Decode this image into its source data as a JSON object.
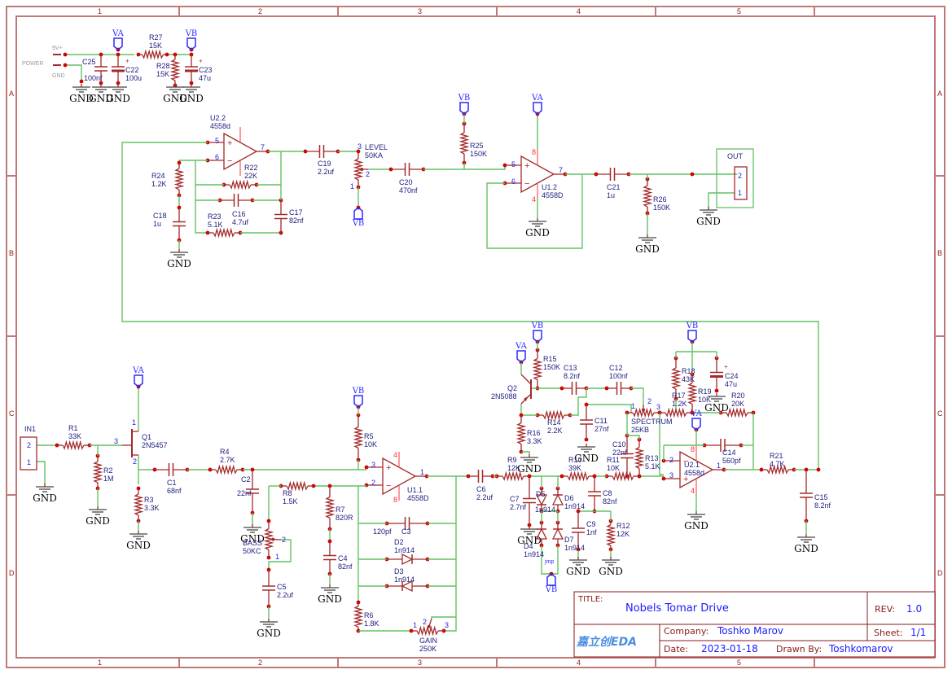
{
  "sheet": {
    "columns": [
      "1",
      "2",
      "3",
      "4",
      "5"
    ],
    "rows": [
      "A",
      "B",
      "C",
      "D"
    ]
  },
  "colors": {
    "wire": "#63c163",
    "part": "#a52a2a",
    "text": "#202080",
    "net": "#2b2bff",
    "junction": "#d40000",
    "frame": "#c07878"
  },
  "power": {
    "vplus": "9V+",
    "title": "POWER",
    "gnd": "GND"
  },
  "gnd_label": "GND",
  "nets": {
    "va": "VA",
    "vb": "VB"
  },
  "jmp_label": "jmp",
  "components": [
    {
      "ref": "C25",
      "value": "100nf"
    },
    {
      "ref": "C22",
      "value": "100u"
    },
    {
      "ref": "R27",
      "value": "15K"
    },
    {
      "ref": "R28",
      "value": "15K"
    },
    {
      "ref": "C23",
      "value": "47u"
    },
    {
      "ref": "U2.2",
      "value": "4558d",
      "pins": [
        "5",
        "6",
        "7"
      ]
    },
    {
      "ref": "R24",
      "value": "1.2K"
    },
    {
      "ref": "C18",
      "value": "1u"
    },
    {
      "ref": "R22",
      "value": "22K"
    },
    {
      "ref": "C16",
      "value": "4.7uf"
    },
    {
      "ref": "R23",
      "value": "5.1K"
    },
    {
      "ref": "C17",
      "value": "82nf"
    },
    {
      "ref": "C19",
      "value": "2.2uf"
    },
    {
      "ref": "LEVEL",
      "value": "50KA",
      "pins": [
        "3",
        "1",
        "2"
      ]
    },
    {
      "ref": "C20",
      "value": "470nf"
    },
    {
      "ref": "R25",
      "value": "150K"
    },
    {
      "ref": "U1.2",
      "value": "4558D",
      "pins": [
        "5",
        "6",
        "7",
        "8",
        "4"
      ]
    },
    {
      "ref": "C21",
      "value": "1u"
    },
    {
      "ref": "R26",
      "value": "150K"
    },
    {
      "ref": "OUT",
      "value": "",
      "pins": [
        "2",
        "1"
      ]
    },
    {
      "ref": "IN1",
      "value": "",
      "pins": [
        "2",
        "1"
      ]
    },
    {
      "ref": "R1",
      "value": "33K"
    },
    {
      "ref": "R2",
      "value": "1M"
    },
    {
      "ref": "Q1",
      "value": "2N5457",
      "pins": [
        "3",
        "1",
        "2"
      ]
    },
    {
      "ref": "R3",
      "value": "3.3K"
    },
    {
      "ref": "C1",
      "value": "68nf"
    },
    {
      "ref": "R4",
      "value": "2.7K"
    },
    {
      "ref": "C2",
      "value": "22nf"
    },
    {
      "ref": "R5",
      "value": "10K"
    },
    {
      "ref": "U1.1",
      "value": "4558D",
      "pins": [
        "3",
        "2",
        "1",
        "4",
        "8"
      ]
    },
    {
      "ref": "R8",
      "value": "1.5K"
    },
    {
      "ref": "R7",
      "value": "820R"
    },
    {
      "ref": "C4",
      "value": "82nf"
    },
    {
      "ref": "BASS",
      "value": "50KC",
      "pins": [
        "2",
        "1"
      ]
    },
    {
      "ref": "C5",
      "value": "2.2uf"
    },
    {
      "ref": "C3",
      "value": "120pf"
    },
    {
      "ref": "D2",
      "value": "1n914"
    },
    {
      "ref": "D3",
      "value": "1n914"
    },
    {
      "ref": "R6",
      "value": "1.8K"
    },
    {
      "ref": "GAIN",
      "value": "250K",
      "pins": [
        "1",
        "2",
        "3"
      ]
    },
    {
      "ref": "C6",
      "value": "2.2uf"
    },
    {
      "ref": "R9",
      "value": "12K"
    },
    {
      "ref": "C7",
      "value": "2.7nf"
    },
    {
      "ref": "D5",
      "value": "1n914"
    },
    {
      "ref": "D6",
      "value": "1n914"
    },
    {
      "ref": "D4",
      "value": "1n914"
    },
    {
      "ref": "D7",
      "value": "1n914"
    },
    {
      "ref": "R10",
      "value": "39K"
    },
    {
      "ref": "R11",
      "value": "10K"
    },
    {
      "ref": "C8",
      "value": "82nf"
    },
    {
      "ref": "C9",
      "value": "1nf"
    },
    {
      "ref": "R12",
      "value": "12K"
    },
    {
      "ref": "C10",
      "value": "22nf"
    },
    {
      "ref": "R13",
      "value": "5.1K"
    },
    {
      "ref": "U2.1",
      "value": "4558d",
      "pins": [
        "2",
        "3",
        "1",
        "8",
        "4"
      ]
    },
    {
      "ref": "C14",
      "value": "560pf"
    },
    {
      "ref": "R20",
      "value": "20K"
    },
    {
      "ref": "R21",
      "value": "4.7K"
    },
    {
      "ref": "C15",
      "value": "8.2nf"
    },
    {
      "ref": "Q2",
      "value": "2N5088"
    },
    {
      "ref": "R15",
      "value": "150K"
    },
    {
      "ref": "C13",
      "value": "8.2nf"
    },
    {
      "ref": "C12",
      "value": "100nf"
    },
    {
      "ref": "R14",
      "value": "2.2K"
    },
    {
      "ref": "C11",
      "value": "27nf"
    },
    {
      "ref": "R16",
      "value": "3.3K"
    },
    {
      "ref": "SPECTRUM",
      "value": "25KB",
      "pins": [
        "1",
        "2",
        "3"
      ]
    },
    {
      "ref": "R17",
      "value": "1.2K"
    },
    {
      "ref": "R18",
      "value": "43K"
    },
    {
      "ref": "R19",
      "value": "10K"
    },
    {
      "ref": "C24",
      "value": "47u"
    }
  ],
  "title_block": {
    "title_key": "TITLE:",
    "title": "Nobels Tomar Drive",
    "rev_key": "REV:",
    "rev": "1.0",
    "logo": "嘉立创EDA",
    "company_key": "Company:",
    "company": "Toshko Marov",
    "sheet_key": "Sheet:",
    "sheet": "1/1",
    "date_key": "Date:",
    "date": "2023-01-18",
    "drawn_key": "Drawn By:",
    "drawn": "Toshkomarov"
  }
}
